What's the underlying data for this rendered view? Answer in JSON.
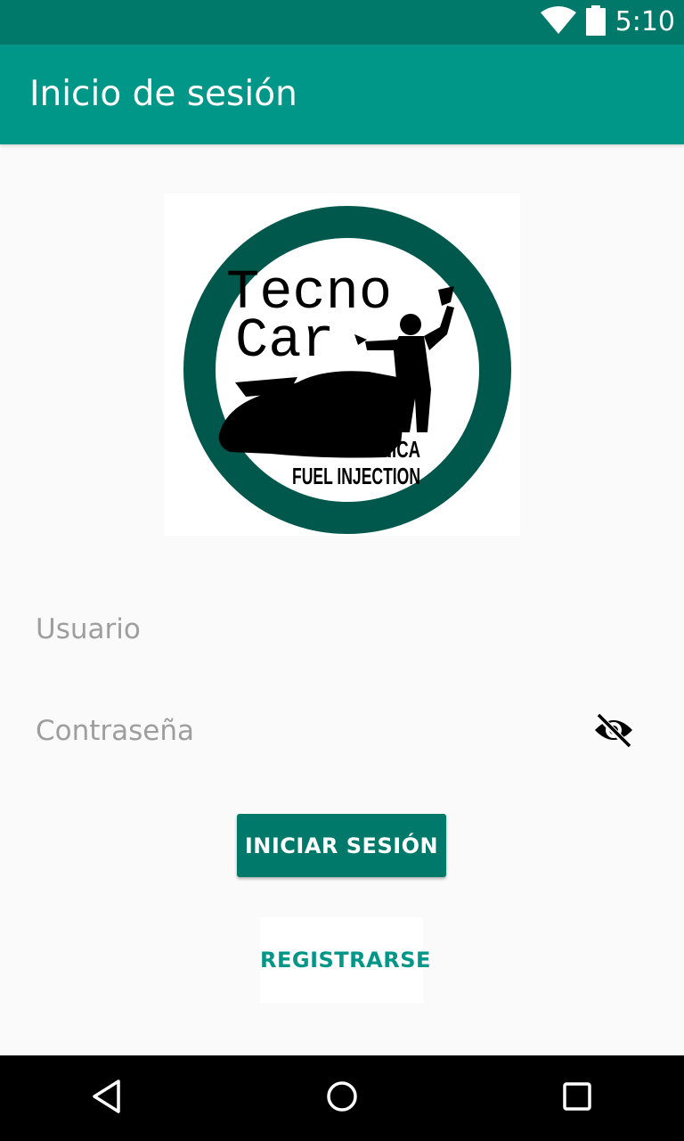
{
  "status_bar": {
    "time": "5:10",
    "icons": [
      "wifi-icon",
      "battery-icon"
    ],
    "background": "#00786a"
  },
  "app_bar": {
    "title": "Inicio de sesión",
    "background": "#009688"
  },
  "logo": {
    "line1": "Tecno",
    "line2": "Car",
    "line3": "MECÁNICA",
    "line4": "FUEL INJECTION",
    "ring_color": "#00584c"
  },
  "form": {
    "username": {
      "value": "",
      "placeholder": "Usuario"
    },
    "password": {
      "value": "",
      "placeholder": "Contraseña",
      "toggle_icon": "visibility-off-icon"
    }
  },
  "buttons": {
    "login_label": "INICIAR SESIÓN",
    "register_label": "REGISTRARSE",
    "primary_color": "#00786a",
    "accent_color": "#009688"
  },
  "nav_bar": {
    "icons": [
      "back-icon",
      "home-icon",
      "recents-icon"
    ]
  }
}
